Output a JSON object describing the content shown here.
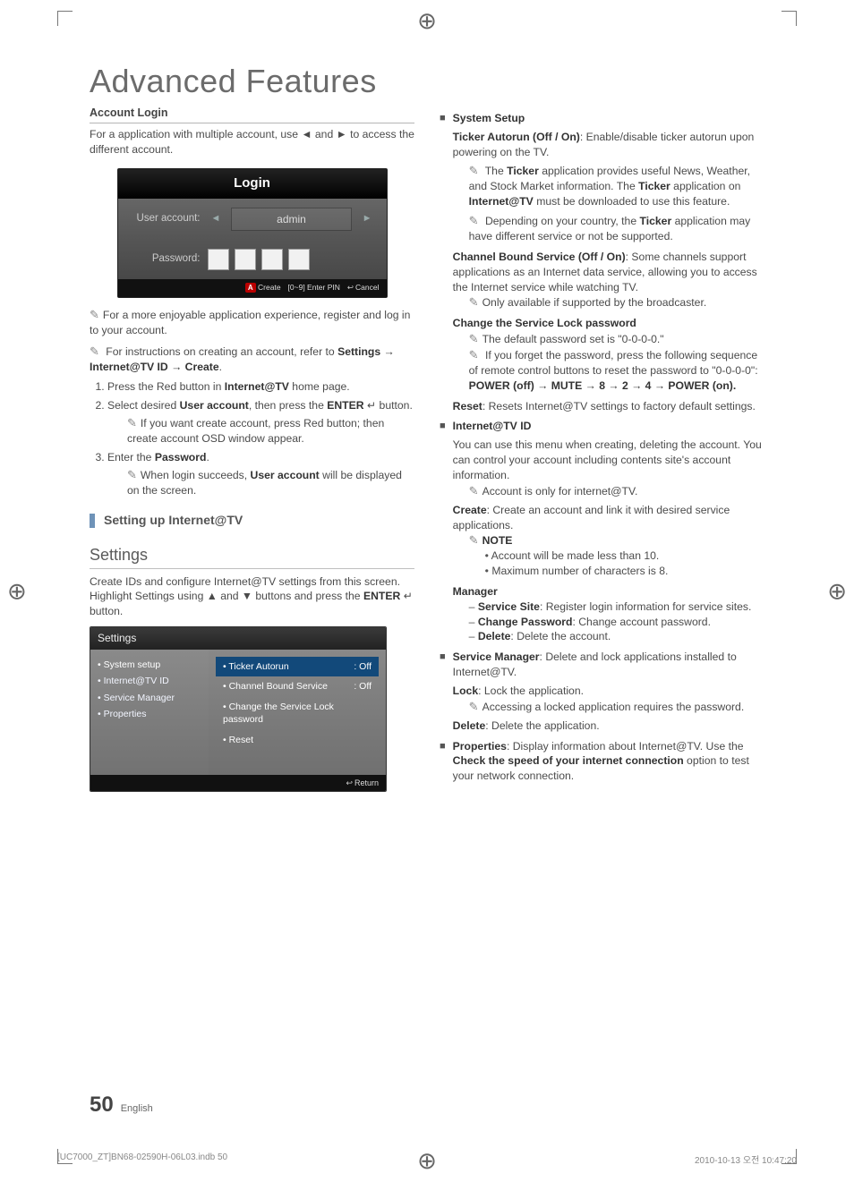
{
  "page": {
    "title": "Advanced Features",
    "section_account_login": "Account Login",
    "account_login_desc_pre": "For a application with multiple account, use ",
    "account_login_desc_mid": " and ",
    "account_login_desc_post": " to access the different account.",
    "arrow_left": "◄",
    "arrow_right": "►",
    "login_ui": {
      "header": "Login",
      "user_account_label": "User account:",
      "user_account_value": "admin",
      "password_label": "Password:",
      "footer_create": "Create",
      "footer_enterpin": "[0~9] Enter PIN",
      "footer_cancel": "Cancel",
      "key_a": "A"
    },
    "note_register": "For a more enjoyable application experience, register and log in to your account.",
    "note_instructions_pre": "For instructions on creating an account, refer to ",
    "note_instructions_path": "Settings → Internet@TV ID → Create",
    "step1_pre": "Press the Red button in ",
    "step1_bold": "Internet@TV",
    "step1_post": " home page.",
    "step2_pre": "Select desired ",
    "step2_bold1": "User account",
    "step2_mid": ", then press the ",
    "step2_bold2": "ENTER",
    "step2_post": " button.",
    "step2_icon": "↵",
    "step2_sub": "If you want create account, press Red button; then create account OSD window appear.",
    "step3_pre": "Enter the ",
    "step3_bold": "Password",
    "step3_sub_pre": "When login succeeds, ",
    "step3_sub_bold": "User account",
    "step3_sub_post": " will be displayed on the screen.",
    "h2_setting": "Setting up Internet@TV",
    "h3_settings": "Settings",
    "settings_desc_pre": "Create IDs and configure Internet@TV settings from this screen. Highlight Settings using ▲ and ▼ buttons and press the ",
    "settings_desc_bold": "ENTER",
    "settings_desc_post": " button.",
    "settings_ui": {
      "title": "Settings",
      "sidebar": [
        "System setup",
        "Internet@TV ID",
        "Service Manager",
        "Properties"
      ],
      "options": [
        {
          "label": "Ticker Autorun",
          "value": ": Off",
          "hl": true
        },
        {
          "label": "Channel Bound Service",
          "value": ": Off",
          "hl": false
        },
        {
          "label": "Change the Service Lock password",
          "value": "",
          "hl": false
        },
        {
          "label": "Reset",
          "value": "",
          "hl": false
        }
      ],
      "footer_return": "Return"
    },
    "right": {
      "system_setup_title": "System Setup",
      "ticker_autorun_b": "Ticker Autorun (Off / On)",
      "ticker_autorun_t": ": Enable/disable ticker autorun upon powering on the TV.",
      "ticker_note1_pre": "The ",
      "ticker_note1_b1": "Ticker",
      "ticker_note1_mid": " application provides useful News, Weather, and Stock Market information. The ",
      "ticker_note1_b2": "Ticker",
      "ticker_note1_mid2": " application on ",
      "ticker_note1_b3": "Internet@TV",
      "ticker_note1_post": " must be downloaded to use this feature.",
      "ticker_note2_pre": "Depending on your country, the ",
      "ticker_note2_b": "Ticker",
      "ticker_note2_post": " application may have different service or not be supported.",
      "cbs_b": "Channel Bound Service (Off / On)",
      "cbs_t": ": Some channels support applications as an Internet data service, allowing you to access the Internet service while watching TV.",
      "cbs_note": "Only available if supported by the broadcaster.",
      "change_pw_title": "Change the Service Lock password",
      "change_pw_note1": "The default password set is \"0-0-0-0.\"",
      "change_pw_note2_pre": "If you forget the password, press the following sequence of remote control buttons to reset the password to \"0-0-0-0\": ",
      "change_pw_seq": "POWER (off) → MUTE → 8 → 2 → 4 → POWER (on).",
      "reset_b": "Reset",
      "reset_t": ": Resets Internet@TV settings to factory default settings.",
      "internet_id_title": "Internet@TV ID",
      "internet_id_desc": "You can use this menu when creating, deleting the account. You can control your account including contents site's account information.",
      "internet_id_note": "Account is only for internet@TV.",
      "create_b": "Create",
      "create_t": ": Create an account and link it with desired service applications.",
      "note_label": "NOTE",
      "note_bullet1": "Account will be made less than 10.",
      "note_bullet2": "Maximum number of characters is 8.",
      "manager_title": "Manager",
      "mgr_service_site_b": "Service Site",
      "mgr_service_site_t": ": Register login information for service sites.",
      "mgr_change_pw_b": "Change Password",
      "mgr_change_pw_t": ": Change account password.",
      "mgr_delete_b": "Delete",
      "mgr_delete_t": ": Delete the account.",
      "service_manager_b": "Service Manager",
      "service_manager_t": ": Delete and lock applications installed to Internet@TV.",
      "lock_b": "Lock",
      "lock_t": ": Lock the application.",
      "lock_note": "Accessing a locked application requires the password.",
      "delete_b": "Delete",
      "delete_t": ": Delete the application.",
      "properties_b": "Properties",
      "properties_t_pre": ": Display information about Internet@TV. Use the ",
      "properties_t_bold": "Check the speed of your internet connection",
      "properties_t_post": " option to test your network connection."
    },
    "footer": {
      "page_no": "50",
      "lang": "English"
    },
    "print": {
      "left": "[UC7000_ZT]BN68-02590H-06L03.indb   50",
      "right": "2010-10-13   오전 10:47:20"
    }
  }
}
